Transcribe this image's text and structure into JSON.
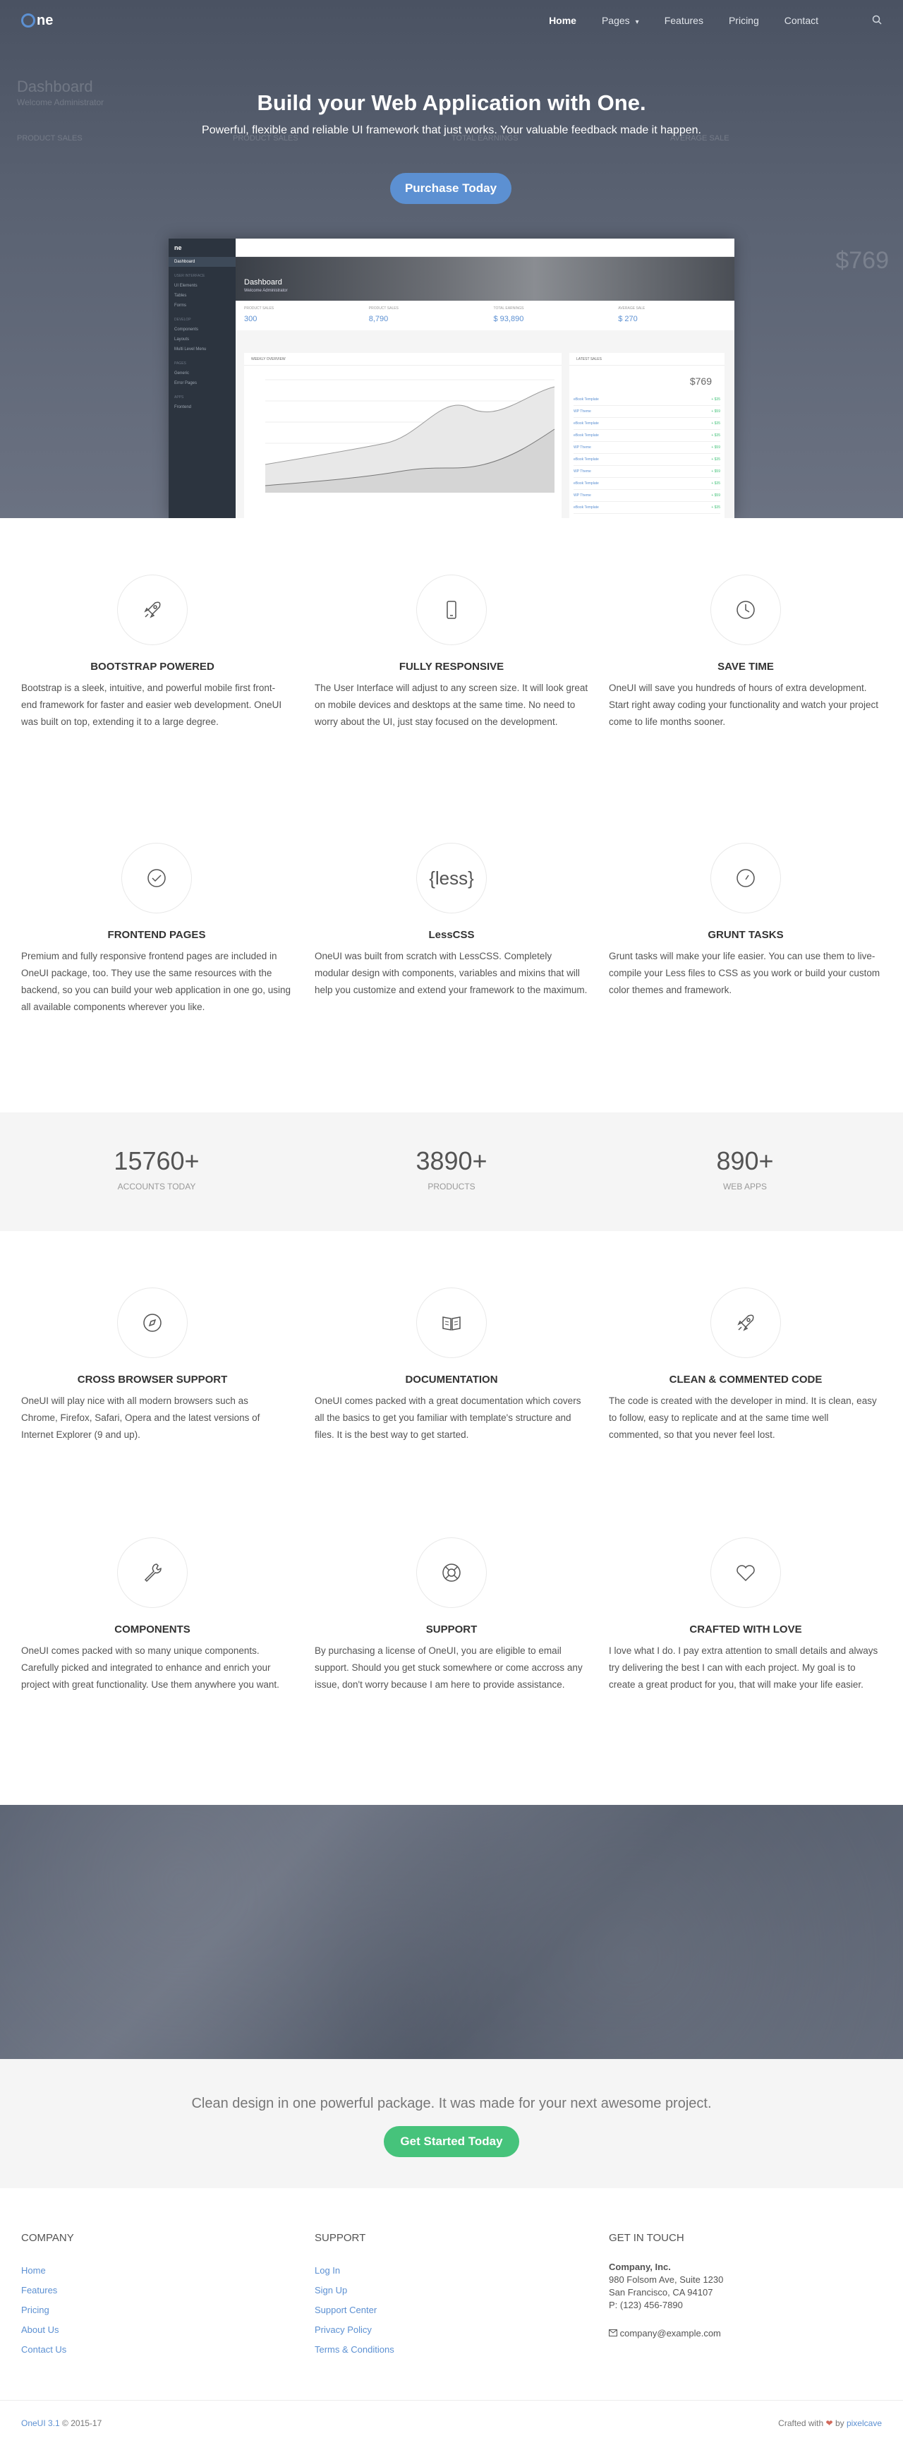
{
  "nav": {
    "logo_text": "ne",
    "items": [
      {
        "label": "Home"
      },
      {
        "label": "Pages"
      },
      {
        "label": "Features"
      },
      {
        "label": "Pricing"
      },
      {
        "label": "Contact"
      }
    ]
  },
  "hero": {
    "title": "Build your Web Application with One.",
    "subtitle": "Powerful, flexible and reliable UI framework that just works. Your valuable feedback made it happen.",
    "button": "Purchase Today",
    "bg_title": "Dashboard",
    "bg_sub": "Welcome Administrator",
    "bg_row1": "PRODUCT SALES",
    "bg_row2": "PRODUCT SALES",
    "bg_row3": "TOTAL EARNINGS",
    "bg_row4": "AVERAGE SALE",
    "bg_num": "$769"
  },
  "dashboard": {
    "logo": "ne",
    "sidebar": [
      "Dashboard",
      "UI Elements",
      "Tables",
      "Forms",
      "Components",
      "Layouts",
      "Multi Level Menu",
      "Generic",
      "Error Pages",
      "Frontend"
    ],
    "heads": [
      "USER INTERFACE",
      "DEVELOP",
      "PAGES",
      "APPS"
    ],
    "banner_title": "Dashboard",
    "banner_sub": "Welcome Administrator",
    "stats": [
      {
        "label": "PRODUCT SALES",
        "value": "300"
      },
      {
        "label": "PRODUCT SALES",
        "value": "8,790"
      },
      {
        "label": "TOTAL EARNINGS",
        "value": "$ 93,890"
      },
      {
        "label": "AVERAGE SALE",
        "value": "$ 270"
      }
    ],
    "chart_head": "WEEKLY OVERVIEW",
    "list_head": "LATEST SALES",
    "list_big": "$769",
    "list_rows": [
      {
        "name": "eBook Template",
        "v": "+ $35"
      },
      {
        "name": "WP Theme",
        "v": "+ $59"
      },
      {
        "name": "eBook Template",
        "v": "+ $35"
      },
      {
        "name": "eBook Template",
        "v": "+ $35"
      },
      {
        "name": "WP Theme",
        "v": "+ $59"
      },
      {
        "name": "eBook Template",
        "v": "+ $35"
      },
      {
        "name": "WP Theme",
        "v": "+ $59"
      },
      {
        "name": "eBook Template",
        "v": "+ $35"
      },
      {
        "name": "WP Theme",
        "v": "+ $59"
      },
      {
        "name": "eBook Template",
        "v": "+ $35"
      }
    ]
  },
  "features1": [
    {
      "icon": "rocket-icon",
      "title": "BOOTSTRAP POWERED",
      "text": "Bootstrap is a sleek, intuitive, and powerful mobile first front-end framework for faster and easier web development. OneUI was built on top, extending it to a large degree."
    },
    {
      "icon": "phone-icon",
      "title": "FULLY RESPONSIVE",
      "text": "The User Interface will adjust to any screen size. It will look great on mobile devices and desktops at the same time. No need to worry about the UI, just stay focused on the development."
    },
    {
      "icon": "clock-icon",
      "title": "SAVE TIME",
      "text": "OneUI will save you hundreds of hours of extra development. Start right away coding your functionality and watch your project come to life months sooner."
    },
    {
      "icon": "check-circle-icon",
      "title": "FRONTEND PAGES",
      "text": "Premium and fully responsive frontend pages are included in OneUI package, too. They use the same resources with the backend, so you can build your web application in one go, using all available components wherever you like."
    },
    {
      "icon": "less-icon",
      "icon_text": "{less}",
      "title": "LessCSS",
      "text": "OneUI was built from scratch with LessCSS. Completely modular design with components, variables and mixins that will help you customize and extend your framework to the maximum."
    },
    {
      "icon": "gauge-icon",
      "title": "GRUNT TASKS",
      "text": "Grunt tasks will make your life easier. You can use them to live-compile your Less files to CSS as you work or build your custom color themes and framework."
    }
  ],
  "counters": [
    {
      "num": "15760+",
      "label": "ACCOUNTS TODAY"
    },
    {
      "num": "3890+",
      "label": "PRODUCTS"
    },
    {
      "num": "890+",
      "label": "WEB APPS"
    }
  ],
  "features2": [
    {
      "icon": "compass-icon",
      "title": "CROSS BROWSER SUPPORT",
      "text": "OneUI will play nice with all modern browsers such as Chrome, Firefox, Safari, Opera and the latest versions of Internet Explorer (9 and up)."
    },
    {
      "icon": "book-icon",
      "title": "DOCUMENTATION",
      "text": "OneUI comes packed with a great documentation which covers all the basics to get you familiar with template's structure and files. It is the best way to get started."
    },
    {
      "icon": "rocket-icon",
      "title": "CLEAN & COMMENTED CODE",
      "text": "The code is created with the developer in mind. It is clean, easy to follow, easy to replicate and at the same time well commented, so that you never feel lost."
    },
    {
      "icon": "wrench-icon",
      "title": "COMPONENTS",
      "text": "OneUI comes packed with so many unique components. Carefully picked and integrated to enhance and enrich your project with great functionality. Use them anywhere you want."
    },
    {
      "icon": "lifebuoy-icon",
      "title": "SUPPORT",
      "text": "By purchasing a license of OneUI, you are eligible to email support. Should you get stuck somewhere or come accross any issue, don't worry because I am here to provide assistance."
    },
    {
      "icon": "heart-icon",
      "title": "CRAFTED WITH LOVE",
      "text": "I love what I do. I pay extra attention to small details and always try delivering the best I can with each project. My goal is to create a great product for you, that will make your life easier."
    }
  ],
  "cta": {
    "text": "Clean design in one powerful package. It was made for your next awesome project.",
    "button": "Get Started Today"
  },
  "footer": {
    "company": {
      "head": "COMPANY",
      "links": [
        "Home",
        "Features",
        "Pricing",
        "About Us",
        "Contact Us"
      ]
    },
    "support": {
      "head": "SUPPORT",
      "links": [
        "Log In",
        "Sign Up",
        "Support Center",
        "Privacy Policy",
        "Terms & Conditions"
      ]
    },
    "contact": {
      "head": "GET IN TOUCH",
      "name": "Company, Inc.",
      "addr1": "980 Folsom Ave, Suite 1230",
      "addr2": "San Francisco, CA 94107",
      "phone": "P: (123) 456-7890",
      "email": "company@example.com"
    },
    "version": "OneUI 3.1",
    "copyright": "© 2015-17",
    "crafted": "Crafted with",
    "by": "by",
    "author": "pixelcave"
  },
  "colors": {
    "primary": "#5c90d2",
    "success": "#46c37b",
    "heart": "#d26a5c"
  }
}
